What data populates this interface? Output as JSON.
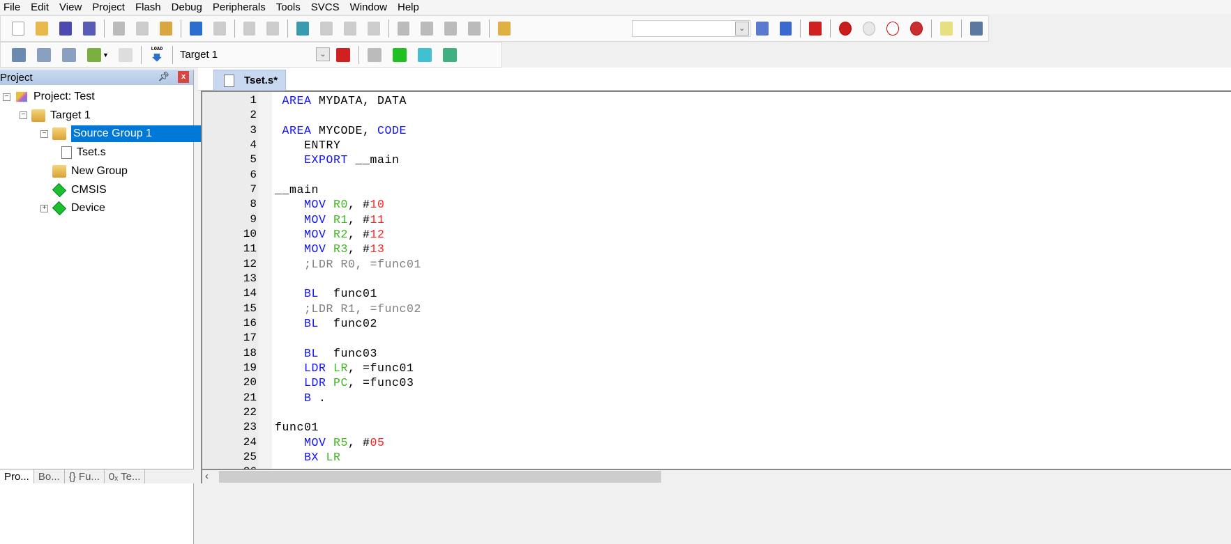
{
  "menu": [
    "File",
    "Edit",
    "View",
    "Project",
    "Flash",
    "Debug",
    "Peripherals",
    "Tools",
    "SVCS",
    "Window",
    "Help"
  ],
  "toolbar1": {
    "icons": [
      "new-file",
      "open-folder",
      "save",
      "save-all",
      "cut",
      "copy",
      "paste",
      "undo",
      "redo",
      "navigate-back",
      "navigate-forward",
      "bookmark-set",
      "bookmark-prev",
      "bookmark-next",
      "bookmark-clear",
      "indent",
      "unindent",
      "comment",
      "uncomment",
      "find-in-files"
    ],
    "right_icons": [
      "find-document",
      "incremental-find",
      "debug-session",
      "breakpoint-insert",
      "breakpoint-disable",
      "breakpoint-disable-all",
      "breakpoint-kill-all",
      "window-layout",
      "configure"
    ]
  },
  "toolbar2": {
    "icons": [
      "translate",
      "build",
      "rebuild",
      "batch-build",
      "stop-build",
      "download"
    ],
    "target": "Target 1",
    "right_icons": [
      "target-options",
      "manage-components",
      "select-packs",
      "pack-installer",
      "runtime-environment"
    ],
    "load_label": "LOAD"
  },
  "project_panel": {
    "title": "Project",
    "pin": "ᵖ",
    "close": "x",
    "tree": [
      {
        "label": "Project: Test",
        "level": 0,
        "icon": "project-icon",
        "toggle": "−"
      },
      {
        "label": "Target 1",
        "level": 1,
        "icon": "target-folder-icon",
        "toggle": "−"
      },
      {
        "label": "Source Group 1",
        "level": 2,
        "icon": "open-folder-icon",
        "toggle": "−",
        "selected": true
      },
      {
        "label": "Tset.s",
        "level": 3,
        "icon": "file-icon"
      },
      {
        "label": "New Group",
        "level": 2,
        "icon": "folder-icon"
      },
      {
        "label": "CMSIS",
        "level": 2,
        "icon": "component-icon"
      },
      {
        "label": "Device",
        "level": 2,
        "icon": "device-component-icon",
        "toggle": "+"
      }
    ],
    "tabs": [
      "Pro...",
      "Bo...",
      "{} Fu...",
      "0ₓ Te..."
    ]
  },
  "editor": {
    "tab": "Tset.s*",
    "lines": [
      [
        [
          " AREA",
          "kw"
        ],
        [
          " MYDATA, DATA",
          "pl"
        ]
      ],
      [],
      [
        [
          " AREA",
          "kw"
        ],
        [
          " MYCODE, ",
          "pl"
        ],
        [
          "CODE",
          "kw"
        ]
      ],
      [
        [
          "    ENTRY",
          "pl"
        ]
      ],
      [
        [
          "    EXPORT",
          "kw"
        ],
        [
          " __main",
          "pl"
        ]
      ],
      [],
      [
        [
          "__main",
          "pl"
        ]
      ],
      [
        [
          "    MOV",
          "kw"
        ],
        [
          " R0",
          "reg"
        ],
        [
          ", #",
          "pl"
        ],
        [
          "10",
          "num"
        ]
      ],
      [
        [
          "    MOV",
          "kw"
        ],
        [
          " R1",
          "reg"
        ],
        [
          ", #",
          "pl"
        ],
        [
          "11",
          "num"
        ]
      ],
      [
        [
          "    MOV",
          "kw"
        ],
        [
          " R2",
          "reg"
        ],
        [
          ", #",
          "pl"
        ],
        [
          "12",
          "num"
        ]
      ],
      [
        [
          "    MOV",
          "kw"
        ],
        [
          " R3",
          "reg"
        ],
        [
          ", #",
          "pl"
        ],
        [
          "13",
          "num"
        ]
      ],
      [
        [
          "    ;LDR R0, =func01",
          "cm"
        ]
      ],
      [],
      [
        [
          "    BL",
          "kw"
        ],
        [
          "  func01",
          "pl"
        ]
      ],
      [
        [
          "    ;LDR R1, =func02",
          "cm"
        ]
      ],
      [
        [
          "    BL",
          "kw"
        ],
        [
          "  func02",
          "pl"
        ]
      ],
      [],
      [
        [
          "    BL",
          "kw"
        ],
        [
          "  func03",
          "pl"
        ]
      ],
      [
        [
          "    LDR",
          "kw"
        ],
        [
          " LR",
          "reg"
        ],
        [
          ", =func01",
          "pl"
        ]
      ],
      [
        [
          "    LDR",
          "kw"
        ],
        [
          " PC",
          "reg"
        ],
        [
          ", =func03",
          "pl"
        ]
      ],
      [
        [
          "    B",
          "kw"
        ],
        [
          " .",
          "pl"
        ]
      ],
      [],
      [
        [
          "func01",
          "pl"
        ]
      ],
      [
        [
          "    MOV",
          "kw"
        ],
        [
          " R5",
          "reg"
        ],
        [
          ", #",
          "pl"
        ],
        [
          "05",
          "num"
        ]
      ],
      [
        [
          "    BX",
          "kw"
        ],
        [
          " LR",
          "reg"
        ]
      ],
      []
    ]
  },
  "colors": {
    "keyword": "#1010ff",
    "register": "#3cb81e",
    "number": "#ff2020",
    "comment": "#808080",
    "selection": "#0078d7"
  }
}
